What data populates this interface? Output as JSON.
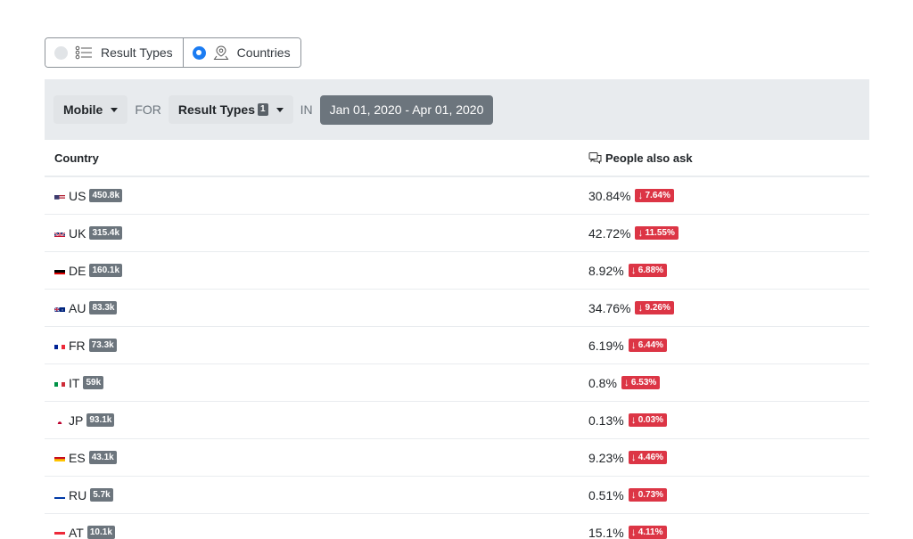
{
  "view_toggle": {
    "result_types_label": "Result Types",
    "countries_label": "Countries",
    "selected": "Countries"
  },
  "filter": {
    "device_label": "Mobile",
    "for_label": "FOR",
    "result_types_label": "Result Types",
    "result_types_count": "1",
    "in_label": "IN",
    "date_range": "Jan 01, 2020 - Apr 01, 2020"
  },
  "table": {
    "col_country": "Country",
    "col_metric": "People also ask",
    "rows": [
      {
        "flag": "us-flag-icon",
        "code": "US",
        "volume": "450.8k",
        "pct": "30.84%",
        "change": "7.64%"
      },
      {
        "flag": "uk-flag-icon",
        "code": "UK",
        "volume": "315.4k",
        "pct": "42.72%",
        "change": "11.55%"
      },
      {
        "flag": "de-flag-icon",
        "code": "DE",
        "volume": "160.1k",
        "pct": "8.92%",
        "change": "6.88%"
      },
      {
        "flag": "au-flag-icon",
        "code": "AU",
        "volume": "83.3k",
        "pct": "34.76%",
        "change": "9.26%"
      },
      {
        "flag": "fr-flag-icon",
        "code": "FR",
        "volume": "73.3k",
        "pct": "6.19%",
        "change": "6.44%"
      },
      {
        "flag": "it-flag-icon",
        "code": "IT",
        "volume": "59k",
        "pct": "0.8%",
        "change": "6.53%"
      },
      {
        "flag": "jp-flag-icon",
        "code": "JP",
        "volume": "93.1k",
        "pct": "0.13%",
        "change": "0.03%"
      },
      {
        "flag": "es-flag-icon",
        "code": "ES",
        "volume": "43.1k",
        "pct": "9.23%",
        "change": "4.46%"
      },
      {
        "flag": "ru-flag-icon",
        "code": "RU",
        "volume": "5.7k",
        "pct": "0.51%",
        "change": "0.73%"
      },
      {
        "flag": "at-flag-icon",
        "code": "AT",
        "volume": "10.1k",
        "pct": "15.1%",
        "change": "4.11%"
      }
    ]
  },
  "colors": {
    "accent_blue": "#1b7cf2",
    "decrease_red": "#dc3545",
    "badge_gray": "#6c757d",
    "filter_bg": "#e8ebee"
  }
}
